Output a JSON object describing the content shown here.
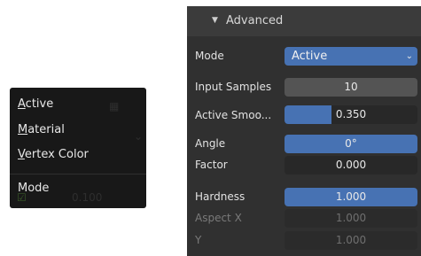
{
  "menu": {
    "items": [
      {
        "label": "Active",
        "underline": "A",
        "rest": "ctive"
      },
      {
        "label": "Material",
        "underline": "M",
        "rest": "aterial"
      },
      {
        "label": "Vertex Color",
        "underline": "V",
        "rest": "ertex Color"
      }
    ],
    "mode_label": "Mode",
    "ghost_value": "0.100"
  },
  "panel": {
    "header_title": "Advanced",
    "mode": {
      "label": "Mode",
      "value": "Active"
    },
    "input_samples": {
      "label": "Input Samples",
      "value": "10"
    },
    "active_smoothing": {
      "label": "Active Smoo...",
      "value": "0.350",
      "fraction": 0.35
    },
    "angle": {
      "label": "Angle",
      "value": "0°",
      "fraction": 1.0
    },
    "factor": {
      "label": "Factor",
      "value": "0.000"
    },
    "hardness": {
      "label": "Hardness",
      "value": "1.000",
      "fraction": 1.0
    },
    "aspect_x": {
      "label": "Aspect X",
      "value": "1.000"
    },
    "aspect_y": {
      "label": "Y",
      "value": "1.000"
    }
  },
  "colors": {
    "accent": "#4772b3",
    "panel_bg": "#303030",
    "menu_bg": "#181818"
  }
}
